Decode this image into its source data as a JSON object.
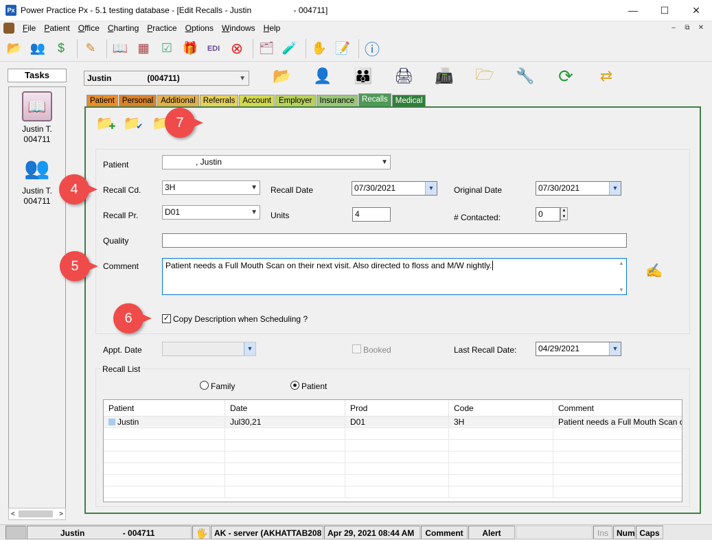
{
  "window": {
    "app_icon": "Px",
    "title": "Power Practice Px  -  5.1 testing database - [Edit Recalls - Justin",
    "title_suffix": "- 004711]",
    "controls": [
      "—",
      "☐",
      "✕"
    ]
  },
  "menu": {
    "items": [
      "File",
      "Patient",
      "Office",
      "Charting",
      "Practice",
      "Options",
      "Windows",
      "Help"
    ],
    "mdi_controls": [
      "–",
      "⧉",
      "✕"
    ]
  },
  "toolbar": {
    "icons": [
      "open-folder-icon",
      "patients-icon",
      "money-transfer-icon",
      "edit-pencil-icon",
      "book-icon",
      "calendar-chart-icon",
      "checklist-icon",
      "gift-box-icon",
      "edi-icon",
      "cancel-icon",
      "document-card-icon",
      "vial-icon",
      "task-hand-icon",
      "notepad-icon",
      "help-circle-icon"
    ]
  },
  "tasks": {
    "header": "Tasks",
    "items": [
      {
        "line1": "Justin T.",
        "line2": "004711",
        "icon": "book-icon"
      },
      {
        "line1": "Justin T.",
        "line2": "004711",
        "icon": "patients-icon"
      }
    ],
    "scroll_left": "<",
    "scroll_right": ">"
  },
  "patient_selector": {
    "name": "Justin",
    "id": "(004711)",
    "caret": "▼"
  },
  "action_icons": [
    "open-folder-icon",
    "person-icon",
    "family-icon",
    "printer-alert-icon",
    "fax-icon",
    "folder-chart-icon",
    "wrench-icon",
    "refresh-icon",
    "folder-swap-icon"
  ],
  "tabs": [
    {
      "label": "Patient",
      "color": "#e98d2a"
    },
    {
      "label": "Personal",
      "color": "#d9822a"
    },
    {
      "label": "Additional",
      "color": "#e3b04b"
    },
    {
      "label": "Referrals",
      "color": "#e6d15a"
    },
    {
      "label": "Account",
      "color": "#d4d84f"
    },
    {
      "label": "Employer",
      "color": "#b9d15c"
    },
    {
      "label": "Insurance",
      "color": "#9bc77a"
    },
    {
      "label": "Recalls",
      "color": "#4e9a57"
    },
    {
      "label": "Medical",
      "color": "#2f7f3a"
    }
  ],
  "recall_icons": [
    "folder-add-icon",
    "folder-check-icon",
    "folder-delete-icon"
  ],
  "form": {
    "patient_label": "Patient",
    "patient_value": ", Justin",
    "recall_cd_label": "Recall Cd.",
    "recall_cd_value": "3H",
    "recall_date_label": "Recall Date",
    "recall_date_value": "07/30/2021",
    "original_date_label": "Original Date",
    "original_date_value": "07/30/2021",
    "recall_pr_label": "Recall Pr.",
    "recall_pr_value": "D01",
    "units_label": "Units",
    "units_value": "4",
    "contacted_label": "# Contacted:",
    "contacted_value": "0",
    "quality_label": "Quality",
    "quality_value": "",
    "comment_label": "Comment",
    "comment_value": "Patient needs a Full Mouth Scan on their next visit. Also directed to floss and M/W nightly.",
    "copy_desc_label": "Copy Description when Scheduling ?",
    "copy_desc_checked": "✓",
    "appt_date_label": "Appt. Date",
    "appt_date_value": "",
    "booked_label": "Booked",
    "last_recall_label": "Last Recall Date:",
    "last_recall_value": "04/29/2021"
  },
  "callouts": [
    "7",
    "4",
    "5",
    "6"
  ],
  "recall_list": {
    "title": "Recall List",
    "radio_family": "Family",
    "radio_patient": "Patient",
    "columns": [
      "Patient",
      "Date",
      "Prod",
      "Code",
      "Comment"
    ],
    "rows": [
      [
        "Justin",
        "Jul30,21",
        "D01",
        "3H",
        "Patient needs a Full Mouth Scan o..."
      ]
    ]
  },
  "statusbar": {
    "patient_name": "Justin",
    "patient_id": "- 004711",
    "server": "AK - server (AKHATTAB208",
    "datetime": "Apr 29, 2021  08:44 AM",
    "comment": "Comment",
    "alert": "Alert",
    "ins": "Ins",
    "num": "Num",
    "caps": "Caps"
  },
  "colors": {
    "panel_border": "#3f7f46",
    "callout": "#ef4b4b",
    "focus_border": "#0078d7"
  }
}
